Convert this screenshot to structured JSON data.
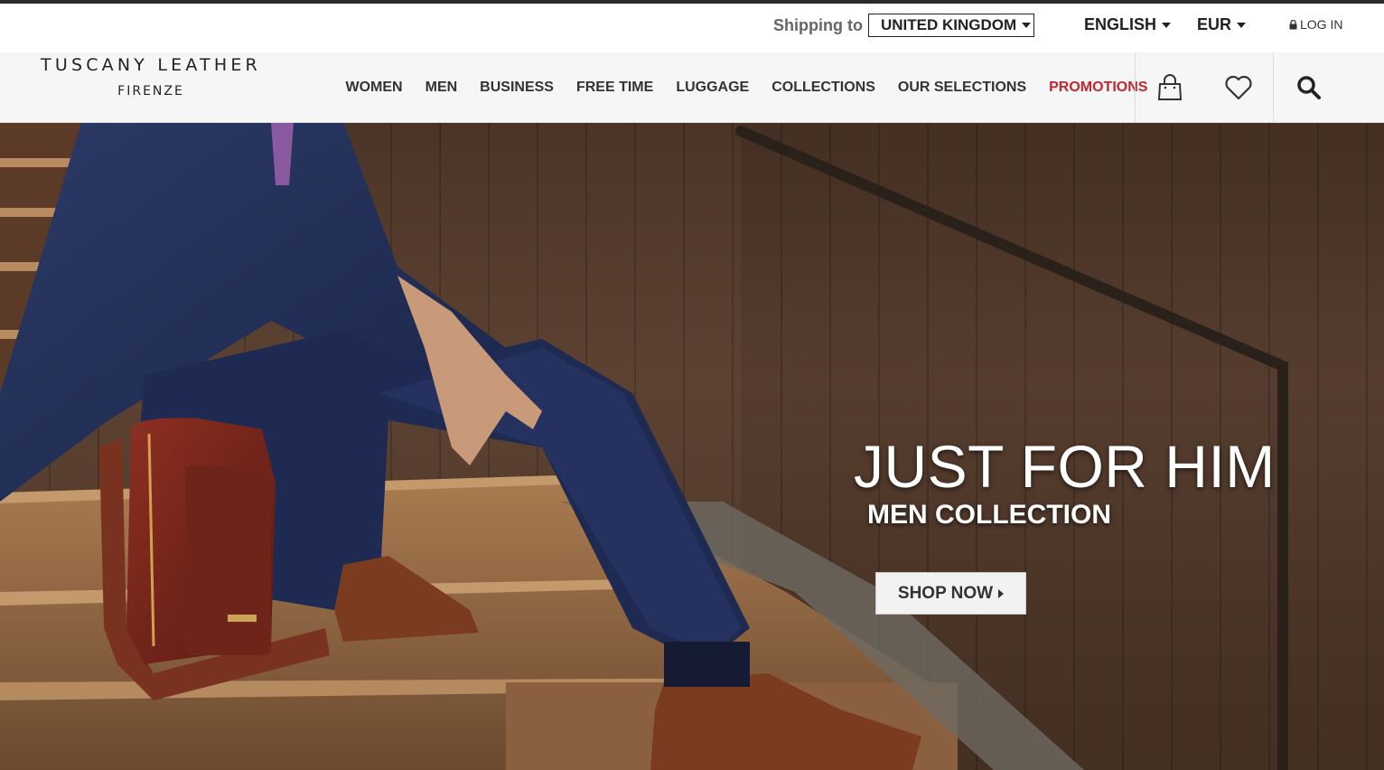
{
  "utility": {
    "shipping_label": "Shipping to",
    "shipping_country": "UNITED KINGDOM",
    "language": "ENGLISH",
    "currency": "EUR",
    "login": "LOG IN"
  },
  "logo": {
    "main": "TUSCANY LEATHER",
    "sub": "FIRENZE"
  },
  "nav": {
    "items": [
      {
        "label": "WOMEN"
      },
      {
        "label": "MEN"
      },
      {
        "label": "BUSINESS"
      },
      {
        "label": "FREE TIME"
      },
      {
        "label": "LUGGAGE"
      },
      {
        "label": "COLLECTIONS"
      },
      {
        "label": "OUR SELECTIONS"
      },
      {
        "label": "PROMOTIONS"
      }
    ],
    "icons": [
      "shopping-bag-icon",
      "heart-icon",
      "search-icon"
    ]
  },
  "hero": {
    "title": "JUST FOR HIM",
    "subtitle": "MEN COLLECTION",
    "cta": "SHOP NOW"
  },
  "colors": {
    "promo": "#c4262d",
    "text": "#333333",
    "nav_bg": "#f6f6f6"
  }
}
